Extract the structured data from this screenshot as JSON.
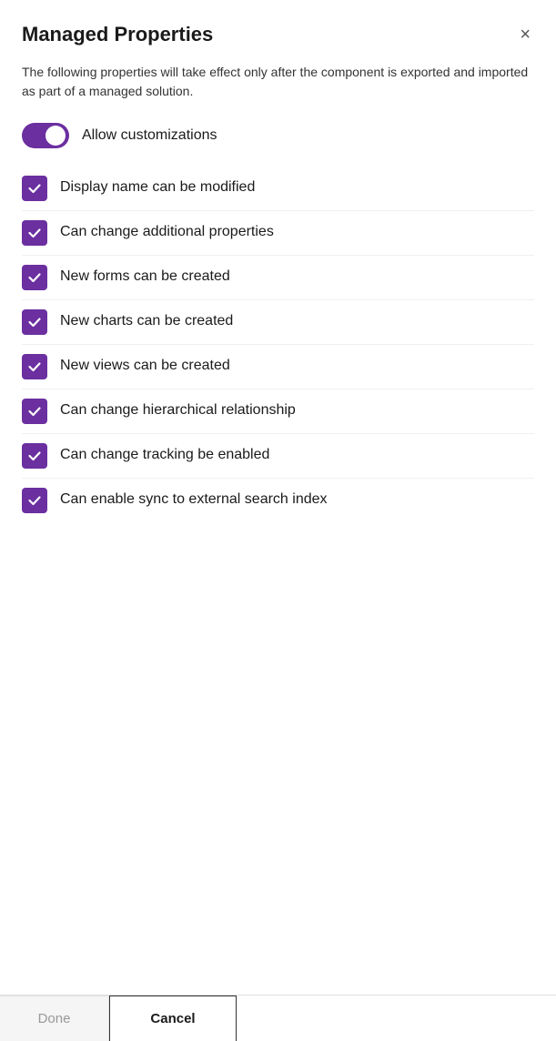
{
  "dialog": {
    "title": "Managed Properties",
    "description": "The following properties will take effect only after the component is exported and imported as part of a managed solution.",
    "close_button_label": "×"
  },
  "toggle": {
    "label": "Allow customizations",
    "checked": true
  },
  "checkboxes": [
    {
      "id": "cb1",
      "label": "Display name can be modified",
      "checked": true
    },
    {
      "id": "cb2",
      "label": "Can change additional properties",
      "checked": true
    },
    {
      "id": "cb3",
      "label": "New forms can be created",
      "checked": true
    },
    {
      "id": "cb4",
      "label": "New charts can be created",
      "checked": true
    },
    {
      "id": "cb5",
      "label": "New views can be created",
      "checked": true
    },
    {
      "id": "cb6",
      "label": "Can change hierarchical relationship",
      "checked": true
    },
    {
      "id": "cb7",
      "label": "Can change tracking be enabled",
      "checked": true
    },
    {
      "id": "cb8",
      "label": "Can enable sync to external search index",
      "checked": true
    }
  ],
  "footer": {
    "done_label": "Done",
    "cancel_label": "Cancel"
  }
}
